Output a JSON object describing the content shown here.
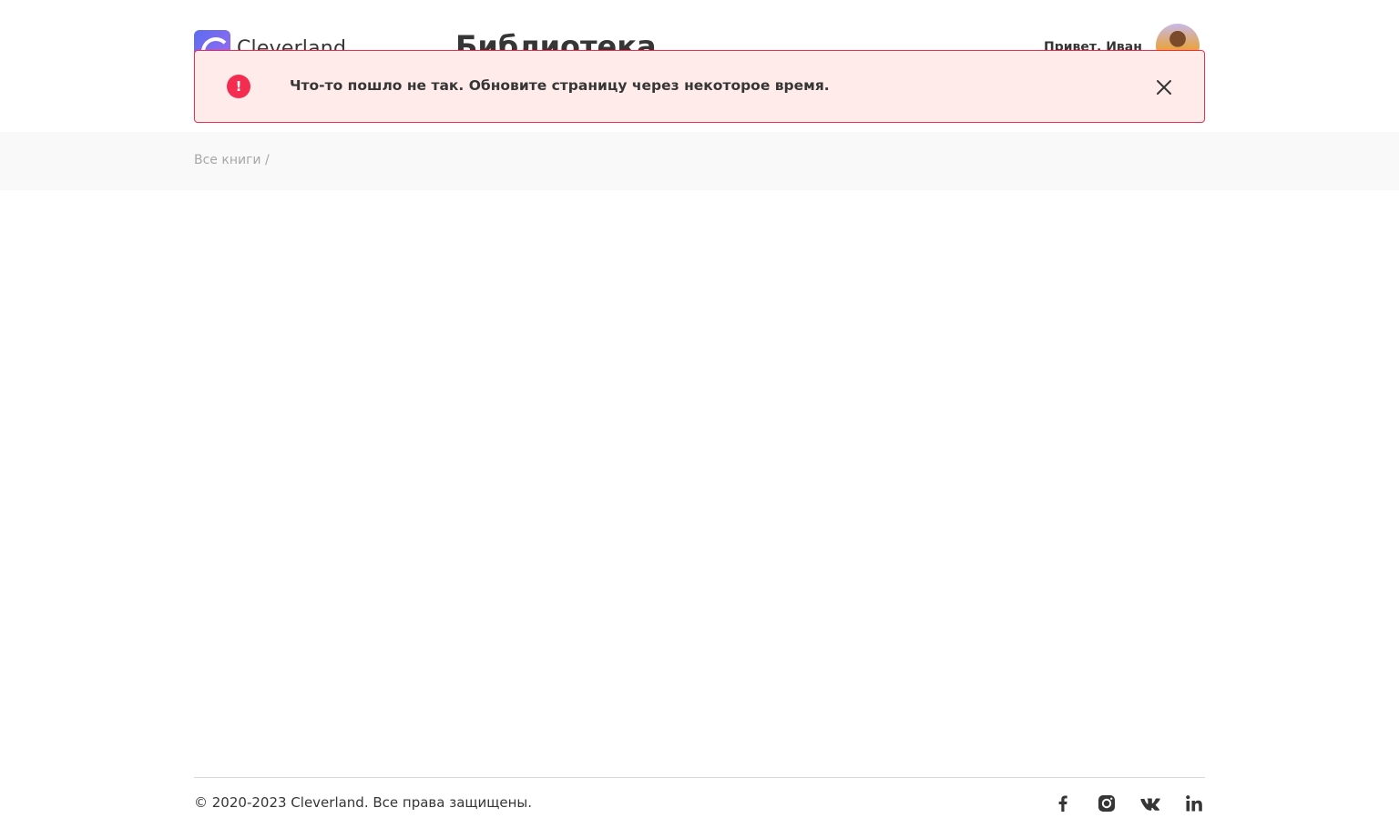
{
  "header": {
    "logo_text": "Cleverland",
    "title": "Библиотека",
    "greeting": "Привет, Иван"
  },
  "toast": {
    "message": "Что-то пошло не так. Обновите страницу через некоторое время.",
    "icon_text": "!",
    "icon": "error-icon",
    "close_icon": "close-icon",
    "accent_color": "#f42c4f",
    "background_color": "#feebea"
  },
  "breadcrumb": {
    "text": "Все книги /"
  },
  "footer": {
    "copyright": "© 2020-2023 Cleverland. Все права защищены.",
    "socials": [
      "facebook-icon",
      "instagram-icon",
      "vk-icon",
      "linkedin-icon"
    ]
  }
}
